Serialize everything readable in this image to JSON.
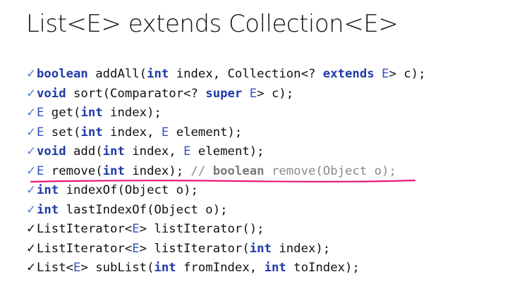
{
  "title": "List<E> extends Collection<E>",
  "lines": [
    {
      "check": "blue",
      "tokens": [
        {
          "t": "kw",
          "v": "boolean"
        },
        {
          "t": "tx",
          "v": " addAll("
        },
        {
          "t": "kw",
          "v": "int"
        },
        {
          "t": "tx",
          "v": " index, Collection<? "
        },
        {
          "t": "kw",
          "v": "extends"
        },
        {
          "t": "tx",
          "v": " "
        },
        {
          "t": "ty",
          "v": "E"
        },
        {
          "t": "tx",
          "v": "> c);"
        }
      ]
    },
    {
      "check": "blue",
      "tokens": [
        {
          "t": "kw",
          "v": "void"
        },
        {
          "t": "tx",
          "v": " sort(Comparator<? "
        },
        {
          "t": "kw",
          "v": "super"
        },
        {
          "t": "tx",
          "v": " "
        },
        {
          "t": "ty",
          "v": "E"
        },
        {
          "t": "tx",
          "v": "> c);"
        }
      ]
    },
    {
      "check": "blue",
      "tokens": [
        {
          "t": "ty",
          "v": "E"
        },
        {
          "t": "tx",
          "v": " get("
        },
        {
          "t": "kw",
          "v": "int"
        },
        {
          "t": "tx",
          "v": " index);"
        }
      ]
    },
    {
      "check": "blue",
      "tokens": [
        {
          "t": "ty",
          "v": "E"
        },
        {
          "t": "tx",
          "v": " set("
        },
        {
          "t": "kw",
          "v": "int"
        },
        {
          "t": "tx",
          "v": " index, "
        },
        {
          "t": "ty",
          "v": "E"
        },
        {
          "t": "tx",
          "v": " element);"
        }
      ]
    },
    {
      "check": "blue",
      "tokens": [
        {
          "t": "kw",
          "v": "void"
        },
        {
          "t": "tx",
          "v": " add("
        },
        {
          "t": "kw",
          "v": "int"
        },
        {
          "t": "tx",
          "v": " index, "
        },
        {
          "t": "ty",
          "v": "E"
        },
        {
          "t": "tx",
          "v": " element);"
        }
      ]
    },
    {
      "check": "blue",
      "tokens": [
        {
          "t": "ty",
          "v": "E"
        },
        {
          "t": "tx",
          "v": " remove("
        },
        {
          "t": "kw",
          "v": "int"
        },
        {
          "t": "tx",
          "v": " index); "
        },
        {
          "t": "cm",
          "v": "// "
        },
        {
          "t": "cmkw",
          "v": "boolean"
        },
        {
          "t": "cm",
          "v": " remove(Object o);"
        }
      ]
    },
    {
      "check": "blue",
      "tokens": [
        {
          "t": "kw",
          "v": "int"
        },
        {
          "t": "tx",
          "v": " indexOf(Object o);"
        }
      ]
    },
    {
      "check": "blue",
      "tokens": [
        {
          "t": "kw",
          "v": "int"
        },
        {
          "t": "tx",
          "v": " lastIndexOf(Object o);"
        }
      ]
    },
    {
      "check": "black",
      "tokens": [
        {
          "t": "tx",
          "v": "ListIterator<"
        },
        {
          "t": "ty",
          "v": "E"
        },
        {
          "t": "tx",
          "v": "> listIterator();"
        }
      ]
    },
    {
      "check": "black",
      "tokens": [
        {
          "t": "tx",
          "v": "ListIterator<"
        },
        {
          "t": "ty",
          "v": "E"
        },
        {
          "t": "tx",
          "v": "> listIterator("
        },
        {
          "t": "kw",
          "v": "int"
        },
        {
          "t": "tx",
          "v": " index);"
        }
      ]
    },
    {
      "check": "black",
      "tokens": [
        {
          "t": "tx",
          "v": "List<"
        },
        {
          "t": "ty",
          "v": "E"
        },
        {
          "t": "tx",
          "v": "> subList("
        },
        {
          "t": "kw",
          "v": "int"
        },
        {
          "t": "tx",
          "v": " fromIndex, "
        },
        {
          "t": "kw",
          "v": "int"
        },
        {
          "t": "tx",
          "v": " toIndex);"
        }
      ]
    }
  ],
  "check_glyph": "✓",
  "colors": {
    "keyword": "#1f3aa8",
    "type": "#3050c0",
    "comment": "#8a8a8a",
    "highlight": "#e8177a"
  }
}
